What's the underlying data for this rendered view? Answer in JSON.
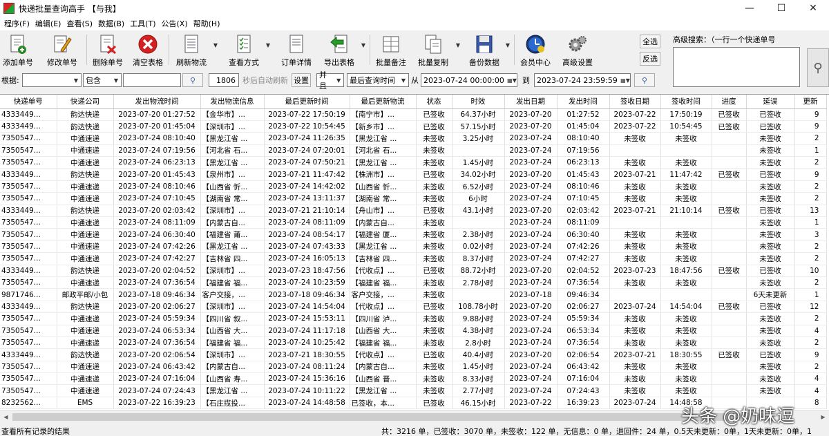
{
  "window": {
    "title": "快递批量查询高手 【与我】"
  },
  "menu": [
    "程序(F)",
    "编辑(E)",
    "查看(S)",
    "数据(B)",
    "工具(T)",
    "公告(X)",
    "帮助(H)"
  ],
  "toolbar": {
    "add": "添加单号",
    "edit": "修改单号",
    "delete": "删除单号",
    "clear": "清空表格",
    "refresh": "刷新物流",
    "view": "查看方式",
    "detail": "订单详情",
    "export": "导出表格",
    "batch_note": "批量备注",
    "batch_copy": "批量复制",
    "backup": "备份数据",
    "member": "会员中心",
    "settings": "高级设置",
    "select_all": "全选",
    "invert": "反选",
    "adv_search": "高级搜索：（一行一个快递单号"
  },
  "filter": {
    "by_label": "根据:",
    "by_value": "",
    "match_value": "包含",
    "keyword": "",
    "interval": "1806",
    "auto_refresh": "秒后自动刷新",
    "set": "设置",
    "logic": "并且",
    "time_field": "最后查询时间",
    "from_label": "从",
    "from": "2023-07-24 00:00:00",
    "to_label": "到",
    "to": "2023-07-24 23:59:59"
  },
  "table": {
    "headers": [
      "快递单号",
      "快递公司",
      "发出物流时间",
      "发出物流信息",
      "最后更新时间",
      "最后更新物流",
      "状态",
      "时效",
      "发出日期",
      "发出时间",
      "签收日期",
      "签收时间",
      "进度",
      "延误",
      "更新"
    ],
    "rows": [
      [
        "4333449...",
        "韵达快递",
        "2023-07-20 01:27:52",
        "【金华市】...",
        "2023-07-22 17:50:19",
        "【南宁市】...",
        "已签收",
        "64.37小时",
        "2023-07-20",
        "01:27:52",
        "2023-07-22",
        "17:50:19",
        "已签收",
        "已签收",
        "9"
      ],
      [
        "4333449...",
        "韵达快递",
        "2023-07-20 01:45:04",
        "【深圳市】...",
        "2023-07-22 10:54:45",
        "【新乡市】...",
        "已签收",
        "57.15小时",
        "2023-07-20",
        "01:45:04",
        "2023-07-22",
        "10:54:45",
        "已签收",
        "已签收",
        "9"
      ],
      [
        "7350547...",
        "中通速递",
        "2023-07-24 08:10:40",
        "【黑龙江省 ...",
        "2023-07-24 11:26:35",
        "【黑龙江省 ...",
        "未签收",
        "3.25小时",
        "2023-07-24",
        "08:10:40",
        "未签收",
        "未签收",
        "",
        "未签收",
        "2"
      ],
      [
        "7350547...",
        "中通速递",
        "2023-07-24 07:19:56",
        "【河北省 石...",
        "2023-07-24 07:20:01",
        "【河北省 石...",
        "未签收",
        "",
        "2023-07-24",
        "07:19:56",
        "",
        "",
        "",
        "未签收",
        "1"
      ],
      [
        "7350547...",
        "中通速递",
        "2023-07-24 06:23:13",
        "【黑龙江省 ...",
        "2023-07-24 07:50:21",
        "【黑龙江省 ...",
        "未签收",
        "1.45小时",
        "2023-07-24",
        "06:23:13",
        "未签收",
        "未签收",
        "",
        "未签收",
        "2"
      ],
      [
        "4333449...",
        "韵达快递",
        "2023-07-20 01:45:43",
        "【泉州市】...",
        "2023-07-21 11:47:42",
        "【株洲市】...",
        "已签收",
        "34.02小时",
        "2023-07-20",
        "01:45:43",
        "2023-07-21",
        "11:47:42",
        "已签收",
        "已签收",
        "9"
      ],
      [
        "7350547...",
        "中通速递",
        "2023-07-24 08:10:46",
        "【山西省 忻...",
        "2023-07-24 14:42:02",
        "【山西省 忻...",
        "未签收",
        "6.52小时",
        "2023-07-24",
        "08:10:46",
        "未签收",
        "未签收",
        "",
        "未签收",
        "2"
      ],
      [
        "7350547...",
        "中通速递",
        "2023-07-24 07:10:45",
        "【湖南省 常...",
        "2023-07-24 13:11:37",
        "【湖南省 常...",
        "未签收",
        "6小时",
        "2023-07-24",
        "07:10:45",
        "未签收",
        "未签收",
        "",
        "未签收",
        "2"
      ],
      [
        "4333449...",
        "韵达快递",
        "2023-07-20 02:03:42",
        "【深圳市】...",
        "2023-07-21 21:10:14",
        "【舟山市】...",
        "已签收",
        "43.1小时",
        "2023-07-20",
        "02:03:42",
        "2023-07-21",
        "21:10:14",
        "已签收",
        "已签收",
        "13"
      ],
      [
        "7350547...",
        "中通速递",
        "2023-07-24 08:11:09",
        "【内蒙古自...",
        "2023-07-24 08:11:09",
        "【内蒙古自...",
        "未签收",
        "",
        "2023-07-24",
        "08:11:09",
        "",
        "",
        "",
        "未签收",
        "1"
      ],
      [
        "7350547...",
        "中通速递",
        "2023-07-24 06:30:40",
        "【福建省 莆...",
        "2023-07-24 08:54:17",
        "【福建省 厦...",
        "未签收",
        "2.38小时",
        "2023-07-24",
        "06:30:40",
        "未签收",
        "未签收",
        "",
        "未签收",
        "3"
      ],
      [
        "7350547...",
        "中通速递",
        "2023-07-24 07:42:26",
        "【黑龙江省 ...",
        "2023-07-24 07:43:33",
        "【黑龙江省 ...",
        "未签收",
        "0.02小时",
        "2023-07-24",
        "07:42:26",
        "未签收",
        "未签收",
        "",
        "未签收",
        "2"
      ],
      [
        "7350547...",
        "中通速递",
        "2023-07-24 07:42:27",
        "【吉林省 四...",
        "2023-07-24 16:05:13",
        "【吉林省 四...",
        "未签收",
        "8.37小时",
        "2023-07-24",
        "07:42:27",
        "未签收",
        "未签收",
        "",
        "未签收",
        "2"
      ],
      [
        "4333449...",
        "韵达快递",
        "2023-07-20 02:04:52",
        "【深圳市】...",
        "2023-07-23 18:47:56",
        "【代收点】...",
        "已签收",
        "88.72小时",
        "2023-07-20",
        "02:04:52",
        "2023-07-23",
        "18:47:56",
        "已签收",
        "已签收",
        "10"
      ],
      [
        "7350547...",
        "中通速递",
        "2023-07-24 07:36:54",
        "【福建省 福...",
        "2023-07-24 10:23:59",
        "【福建省 福...",
        "未签收",
        "2.78小时",
        "2023-07-24",
        "07:36:54",
        "未签收",
        "未签收",
        "",
        "未签收",
        "2"
      ],
      [
        "9871746...",
        "邮政平邮/小包",
        "2023-07-18 09:46:34",
        "客户交接，...",
        "2023-07-18 09:46:34",
        "客户交接，...",
        "未签收",
        "",
        "2023-07-18",
        "09:46:34",
        "",
        "",
        "",
        "6天未更新",
        "1"
      ],
      [
        "4333449...",
        "韵达快递",
        "2023-07-20 02:06:27",
        "【深圳市】...",
        "2023-07-24 14:54:04",
        "【代收点】...",
        "已签收",
        "108.78小时",
        "2023-07-20",
        "02:06:27",
        "2023-07-24",
        "14:54:04",
        "已签收",
        "已签收",
        "12"
      ],
      [
        "7350547...",
        "中通速递",
        "2023-07-24 05:59:34",
        "【四川省 叙...",
        "2023-07-24 15:53:11",
        "【四川省 泸...",
        "未签收",
        "9.88小时",
        "2023-07-24",
        "05:59:34",
        "未签收",
        "未签收",
        "",
        "未签收",
        "2"
      ],
      [
        "7350547...",
        "中通速递",
        "2023-07-24 06:53:34",
        "【山西省 大...",
        "2023-07-24 11:17:18",
        "【山西省 大...",
        "未签收",
        "4.38小时",
        "2023-07-24",
        "06:53:34",
        "未签收",
        "未签收",
        "",
        "未签收",
        "4"
      ],
      [
        "7350547...",
        "中通速递",
        "2023-07-24 07:36:54",
        "【福建省 福...",
        "2023-07-24 10:25:42",
        "【福建省 福...",
        "未签收",
        "2.8小时",
        "2023-07-24",
        "07:36:54",
        "未签收",
        "未签收",
        "",
        "未签收",
        "2"
      ],
      [
        "4333449...",
        "韵达快递",
        "2023-07-20 02:06:54",
        "【深圳市】...",
        "2023-07-21 18:30:55",
        "【代收点】...",
        "已签收",
        "40.4小时",
        "2023-07-20",
        "02:06:54",
        "2023-07-21",
        "18:30:55",
        "已签收",
        "已签收",
        "9"
      ],
      [
        "7350547...",
        "中通速递",
        "2023-07-24 06:43:42",
        "【内蒙古自...",
        "2023-07-24 08:11:24",
        "【内蒙古自...",
        "未签收",
        "1.45小时",
        "2023-07-24",
        "06:43:42",
        "未签收",
        "未签收",
        "",
        "未签收",
        "2"
      ],
      [
        "7350547...",
        "中通速递",
        "2023-07-24 07:16:04",
        "【山西省 寿...",
        "2023-07-24 15:36:16",
        "【山西省 晋...",
        "未签收",
        "8.33小时",
        "2023-07-24",
        "07:16:04",
        "未签收",
        "未签收",
        "",
        "未签收",
        "4"
      ],
      [
        "7350547...",
        "中通速递",
        "2023-07-24 07:24:43",
        "【黑龙江省 ...",
        "2023-07-24 10:11:22",
        "【黑龙江省 ...",
        "未签收",
        "2.77小时",
        "2023-07-24",
        "07:24:43",
        "未签收",
        "未签收",
        "",
        "未签收",
        "4"
      ],
      [
        "8232562...",
        "EMS",
        "2023-07-22 16:39:23",
        "【石庄揽投...",
        "2023-07-24 14:48:58",
        "已签收，本...",
        "已签收",
        "46.15小时",
        "2023-07-22",
        "16:39:23",
        "2023-07-24",
        "14:48:58",
        "",
        "",
        "8"
      ]
    ]
  },
  "status": {
    "left": "查看所有记录的结果",
    "right": "共：3216 单，已签收：3070 单，未签收：122 单，无信息：0 单，退回件：24 单，0.5天未更新：0单，1天未更新：0单，1"
  },
  "watermark": "头条 @奶味逗",
  "colors": {
    "delete_red": "#d32020",
    "table_bg": "#ffffff",
    "window_bg": "#f0f0f0"
  }
}
